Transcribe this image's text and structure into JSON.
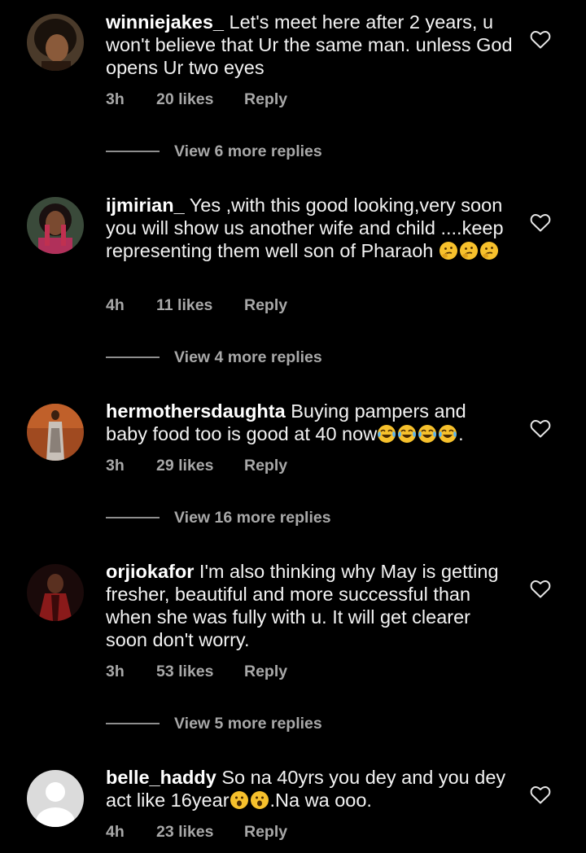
{
  "comments": [
    {
      "username": "winniejakes_",
      "text": " Let's meet here after 2 years, u won't believe that Ur the same man. unless God opens Ur two eyes",
      "time": "3h",
      "likes": "20 likes",
      "reply": "Reply",
      "view_more": "View 6 more replies"
    },
    {
      "username": "ijmirian_",
      "text": " Yes ,with this good looking,very soon you will show us another wife and child ....keep representing them well son of Pharaoh",
      "emoji_after": "🤔🤔🤔",
      "time": "4h",
      "likes": "11 likes",
      "reply": "Reply",
      "view_more": "View 4 more replies"
    },
    {
      "username": "hermothersdaughta",
      "text": " Buying pampers and baby food too is good at 40 now",
      "emoji_after": "😂😂😂😂",
      "text_tail": ".",
      "time": "3h",
      "likes": "29 likes",
      "reply": "Reply",
      "view_more": "View 16 more replies"
    },
    {
      "username": "orjiokafor",
      "text": " I'm also thinking why May is getting fresher, beautiful and more successful  than when she was fully with u. It will get clearer soon don't worry.",
      "time": "3h",
      "likes": "53 likes",
      "reply": "Reply",
      "view_more": "View 5 more replies"
    },
    {
      "username": "belle_haddy",
      "text": " So na 40yrs you dey and you dey act like 16year",
      "emoji_after": "😮😮",
      "text_tail": ".Na wa ooo.",
      "time": "4h",
      "likes": "23 likes",
      "reply": "Reply"
    }
  ],
  "icons": {
    "like": "heart-outline-icon",
    "avatar_default": "default-avatar-icon"
  },
  "colors": {
    "background": "#000000",
    "text": "#ffffff",
    "secondary_text": "#a8a8a8"
  }
}
